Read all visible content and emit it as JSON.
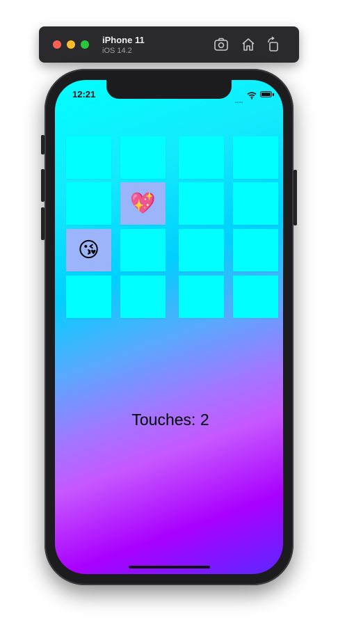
{
  "window": {
    "device_name": "iPhone 11",
    "os_version": "iOS 14.2"
  },
  "toolbar_icons": [
    "camera-screenshot-icon",
    "home-icon",
    "rotate-icon"
  ],
  "status_bar": {
    "time": "12:21"
  },
  "game": {
    "cards": [
      {
        "id": "r1c1",
        "face": ""
      },
      {
        "id": "r1c2",
        "face": ""
      },
      {
        "id": "r1c3",
        "face": ""
      },
      {
        "id": "r1c4",
        "face": ""
      },
      {
        "id": "r2c1",
        "face": ""
      },
      {
        "id": "r2c2",
        "face": "💖"
      },
      {
        "id": "r2c3",
        "face": ""
      },
      {
        "id": "r2c4",
        "face": ""
      },
      {
        "id": "r3c1",
        "face": "😘"
      },
      {
        "id": "r3c2",
        "face": ""
      },
      {
        "id": "r3c3",
        "face": ""
      },
      {
        "id": "r3c4",
        "face": ""
      },
      {
        "id": "r4c1",
        "face": ""
      },
      {
        "id": "r4c2",
        "face": ""
      },
      {
        "id": "r4c3",
        "face": ""
      },
      {
        "id": "r4c4",
        "face": ""
      }
    ],
    "touches_label": "Touches: 2"
  },
  "colors": {
    "card_back": "#00ffff",
    "card_face": "#9bb4fa",
    "gradient_top": "#00ffff",
    "gradient_bottom": "#5d28ff"
  }
}
